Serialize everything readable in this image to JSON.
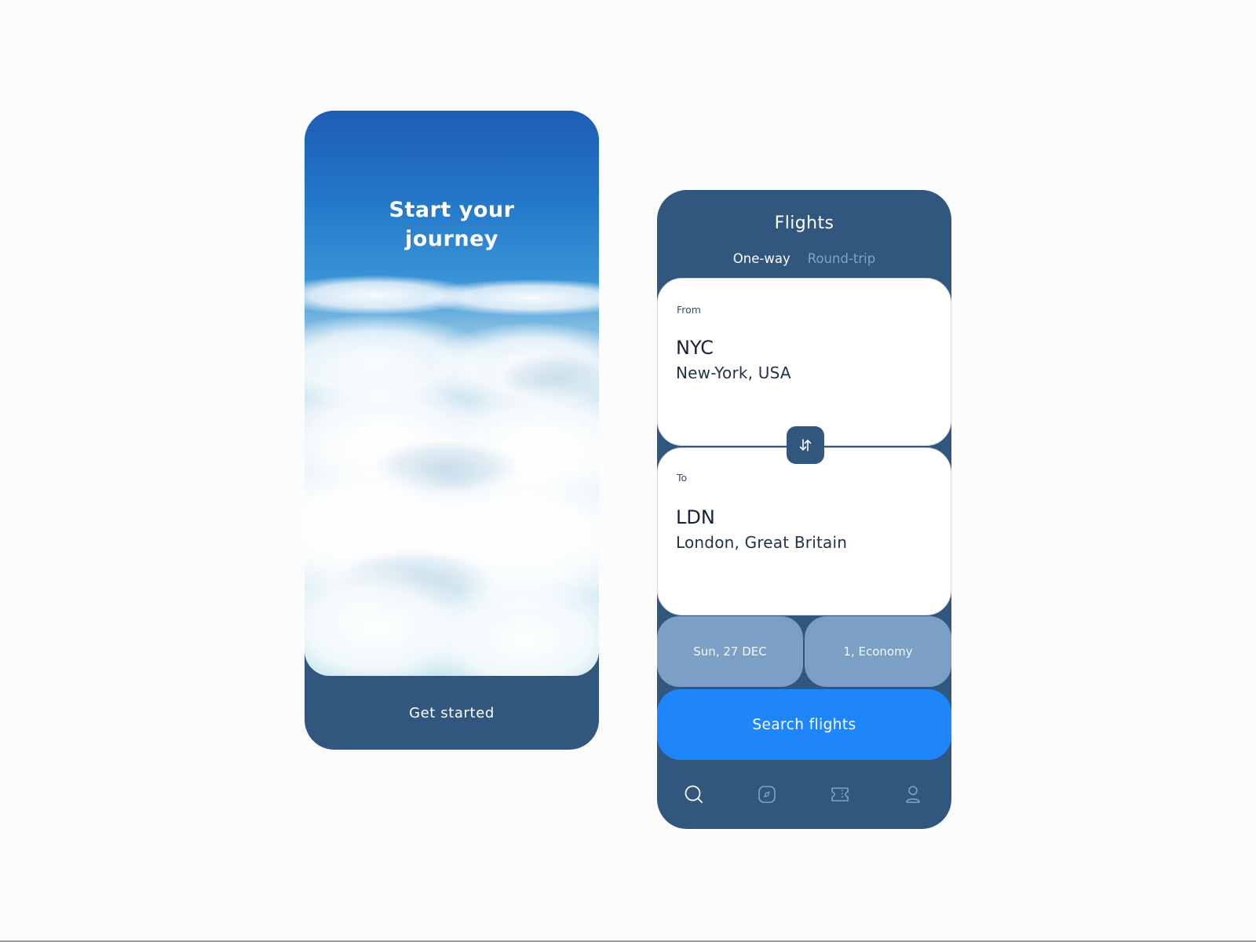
{
  "onboarding": {
    "title_line1": "Start your",
    "title_line2": "journey",
    "cta_label": "Get started"
  },
  "flights": {
    "title": "Flights",
    "tabs": [
      {
        "label": "One-way",
        "active": true
      },
      {
        "label": "Round-trip",
        "active": false
      }
    ],
    "from": {
      "label": "From",
      "code": "NYC",
      "city": "New-York, USA"
    },
    "to": {
      "label": "To",
      "code": "LDN",
      "city": "London, Great Britain"
    },
    "swap_icon": "swap-arrows-icon",
    "date": "Sun, 27 DEC",
    "passengers_class": "1, Economy",
    "search_label": "Search flights",
    "nav": [
      {
        "icon": "search-icon",
        "active": true
      },
      {
        "icon": "explore-icon",
        "active": false
      },
      {
        "icon": "ticket-icon",
        "active": false
      },
      {
        "icon": "profile-icon",
        "active": false
      }
    ]
  },
  "colors": {
    "page_background": "#fcfcfd",
    "panel_navy": "#31577f",
    "pill_blue": "#7b9fc5",
    "accent_blue": "#1e86fa",
    "inactive_tab": "#7fa3c8",
    "card_white": "#ffffff"
  }
}
